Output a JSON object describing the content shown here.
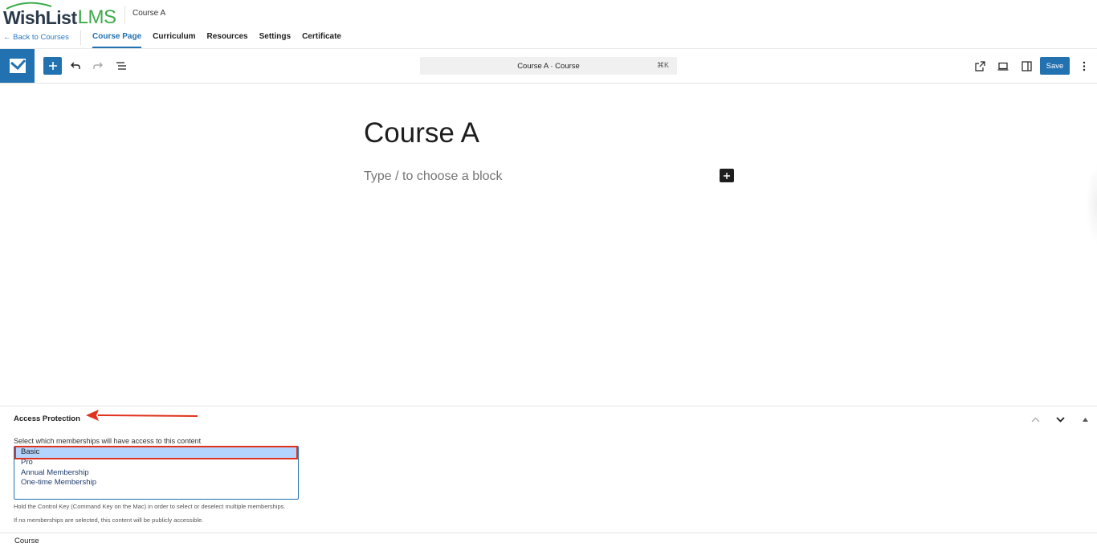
{
  "brand": {
    "logo_part1": "WishList",
    "logo_part2": "LMS"
  },
  "header": {
    "course_title": "Course A",
    "back_link": "← Back to Courses",
    "tabs": [
      {
        "label": "Course Page",
        "active": true
      },
      {
        "label": "Curriculum",
        "active": false
      },
      {
        "label": "Resources",
        "active": false
      },
      {
        "label": "Settings",
        "active": false
      },
      {
        "label": "Certificate",
        "active": false
      }
    ]
  },
  "toolbar": {
    "command_bar_text": "Course A · Course",
    "command_shortcut": "⌘K",
    "save_label": "Save",
    "icons": [
      "site-icon",
      "add-block-icon",
      "undo-icon",
      "redo-icon",
      "document-overview-icon",
      "view-post-icon",
      "preview-device-icon",
      "settings-sidebar-icon",
      "options-menu-icon"
    ]
  },
  "editor": {
    "post_title": "Course A",
    "block_placeholder": "Type / to choose a block"
  },
  "metabox": {
    "title": "Access Protection",
    "description": "Select which memberships will have access to this content",
    "options": [
      {
        "label": "Basic",
        "selected": true
      },
      {
        "label": "Pro",
        "selected": false
      },
      {
        "label": "Annual Membership",
        "selected": false
      },
      {
        "label": "One-time Membership",
        "selected": false
      }
    ],
    "hint_multi": "Hold the Control Key (Command Key on the Mac) in order to select or deselect multiple memberships.",
    "hint_public": "If no memberships are selected, this content will be publicly accessible."
  },
  "footer": {
    "breadcrumb": "Course"
  },
  "colors": {
    "accent": "#2271b1",
    "logo_green": "#3daa4a",
    "annotation_red": "#e0321e",
    "selected_bg": "#b3d4fc"
  }
}
